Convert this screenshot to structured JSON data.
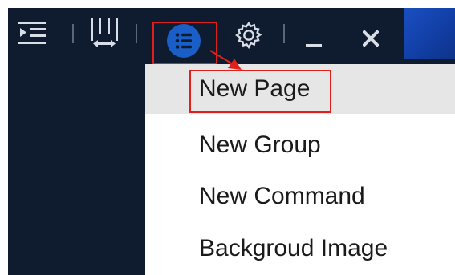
{
  "toolbar": {
    "icons": [
      "indent-list-icon",
      "column-resize-icon",
      "list-menu-icon",
      "gear-icon",
      "minimize-icon",
      "close-icon"
    ]
  },
  "menu": {
    "items": [
      {
        "label": "New Page",
        "active": true
      },
      {
        "label": "New Group",
        "active": false
      },
      {
        "label": "New Command",
        "active": false
      },
      {
        "label": "Backgroud Image",
        "active": false
      }
    ]
  },
  "colors": {
    "titlebar_bg": "#0f1b2e",
    "accent_blue": "#1a5fc7",
    "highlight_red": "#e0201c",
    "active_item_bg": "#e6e6e6"
  }
}
